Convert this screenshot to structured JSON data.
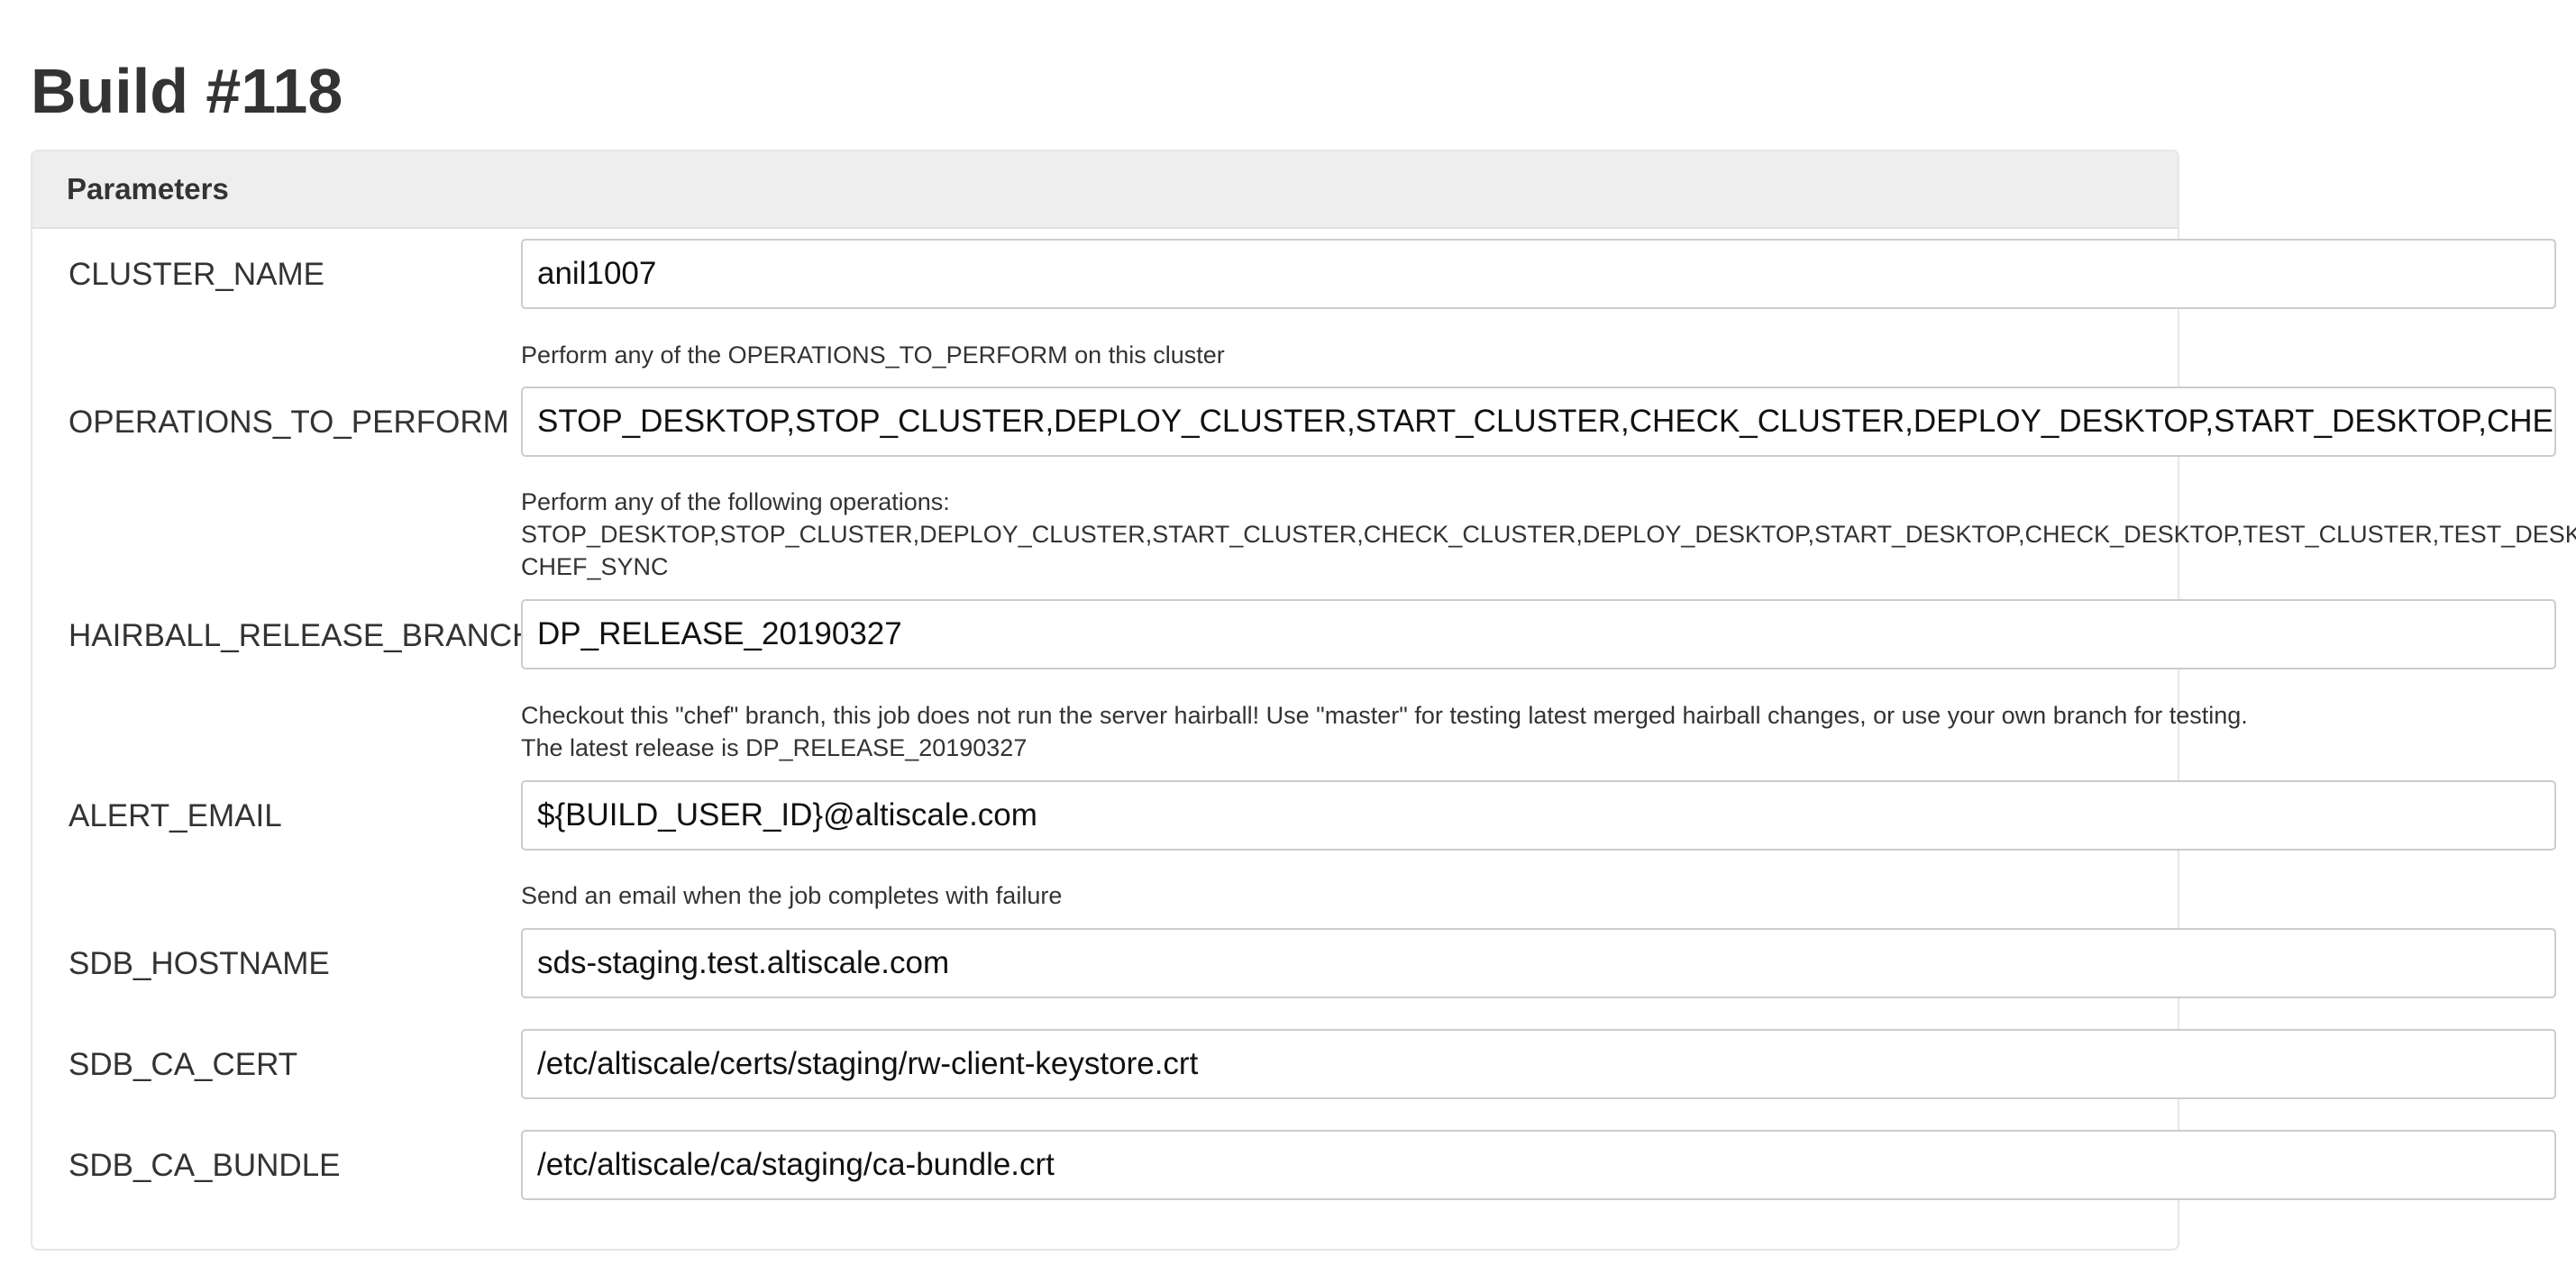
{
  "page": {
    "title": "Build #118"
  },
  "panel": {
    "heading": "Parameters"
  },
  "params": [
    {
      "name": "CLUSTER_NAME",
      "value": "anil1007",
      "description": "Perform any of the OPERATIONS_TO_PERFORM on this cluster"
    },
    {
      "name": "OPERATIONS_TO_PERFORM",
      "value": "STOP_DESKTOP,STOP_CLUSTER,DEPLOY_CLUSTER,START_CLUSTER,CHECK_CLUSTER,DEPLOY_DESKTOP,START_DESKTOP,CHECK_DESKTOP,TEST_CLUSTER,TEST_DESKTOP",
      "description_lines": [
        "Perform any of the following operations:",
        "STOP_DESKTOP,STOP_CLUSTER,DEPLOY_CLUSTER,START_CLUSTER,CHECK_CLUSTER,DEPLOY_DESKTOP,START_DESKTOP,CHECK_DESKTOP,TEST_CLUSTER,TEST_DESKTOP",
        "CHEF_SYNC"
      ]
    },
    {
      "name": "HAIRBALL_RELEASE_BRANCH",
      "value": "DP_RELEASE_20190327",
      "description_lines": [
        "Checkout this \"chef\" branch, this job does not run the server hairball! Use \"master\" for testing latest merged hairball changes, or use your own branch for testing.",
        "The latest release is DP_RELEASE_20190327"
      ]
    },
    {
      "name": "ALERT_EMAIL",
      "value": "${BUILD_USER_ID}@altiscale.com",
      "description": "Send an email when the job completes with failure"
    },
    {
      "name": "SDB_HOSTNAME",
      "value": "sds-staging.test.altiscale.com"
    },
    {
      "name": "SDB_CA_CERT",
      "value": "/etc/altiscale/certs/staging/rw-client-keystore.crt"
    },
    {
      "name": "SDB_CA_BUNDLE",
      "value": "/etc/altiscale/ca/staging/ca-bundle.crt"
    }
  ]
}
